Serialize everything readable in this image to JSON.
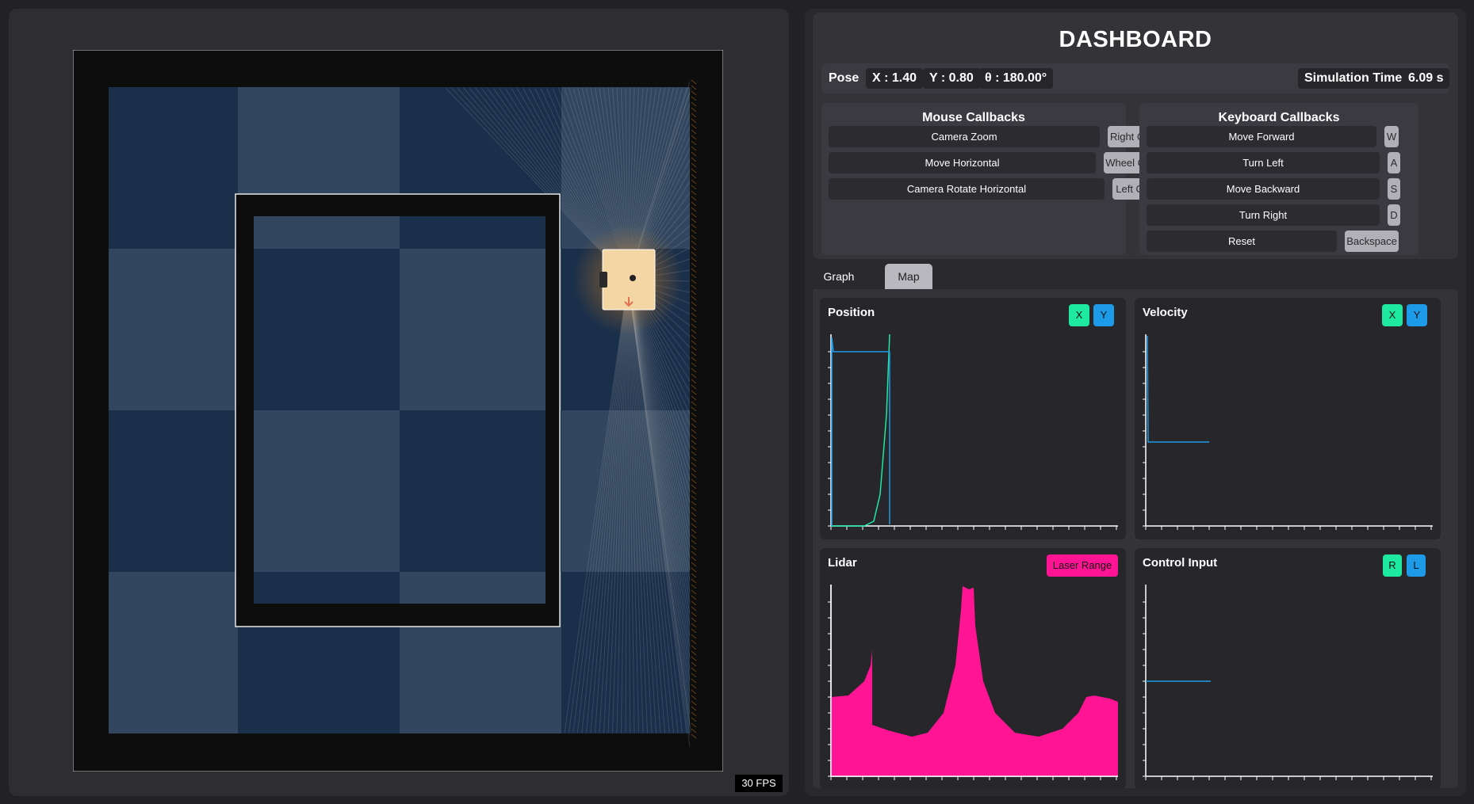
{
  "simulation": {
    "fps_label": "30 FPS"
  },
  "dashboard": {
    "title": "DASHBOARD",
    "pose": {
      "label": "Pose",
      "x": "X : 1.40",
      "y": "Y : 0.80",
      "theta": "θ : 180.00°"
    },
    "sim_time": {
      "label": "Simulation Time",
      "value": "6.09 s"
    },
    "mouse_callbacks": {
      "title": "Mouse Callbacks",
      "items": [
        {
          "label": "Camera Zoom",
          "key": "Right Click"
        },
        {
          "label": "Move Horizontal",
          "key": "Wheel Click"
        },
        {
          "label": "Camera Rotate Horizontal",
          "key": "Left  Click"
        }
      ]
    },
    "keyboard_callbacks": {
      "title": "Keyboard Callbacks",
      "items": [
        {
          "label": "Move Forward",
          "key": "W"
        },
        {
          "label": "Turn Left",
          "key": "A"
        },
        {
          "label": "Move Backward",
          "key": "S"
        },
        {
          "label": "Turn Right",
          "key": "D"
        },
        {
          "label": "Reset",
          "key": "Backspace"
        }
      ]
    },
    "tabs": [
      "Graph",
      "Map"
    ],
    "active_tab": "Map",
    "plots": {
      "position": {
        "title": "Position",
        "legend": [
          "X",
          "Y"
        ]
      },
      "velocity": {
        "title": "Velocity",
        "legend": [
          "X",
          "Y"
        ]
      },
      "lidar": {
        "title": "Lidar",
        "legend": [
          "Laser Range"
        ]
      },
      "control": {
        "title": "Control Input",
        "legend": [
          "R",
          "L"
        ]
      }
    }
  },
  "colors": {
    "accent_green": "#1de9a0",
    "accent_blue": "#1e9be8",
    "accent_pink": "#ff1493",
    "floor_dark": "#1a2f4a",
    "floor_light": "#32475f"
  }
}
